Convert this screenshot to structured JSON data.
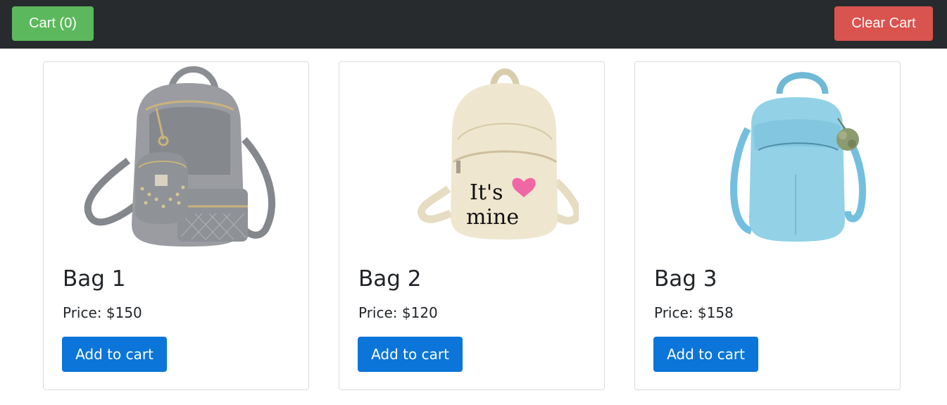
{
  "navbar": {
    "cart_label": "Cart (0)",
    "clear_label": "Clear Cart"
  },
  "products": [
    {
      "name": "Bag 1",
      "price": "Price: $150",
      "button": "Add to cart",
      "image": "grey-backpack-with-pouch"
    },
    {
      "name": "Bag 2",
      "price": "Price: $120",
      "button": "Add to cart",
      "image": "beige-backpack-its-mine"
    },
    {
      "name": "Bag 3",
      "price": "Price: $158",
      "button": "Add to cart",
      "image": "light-blue-backpack-with-pompom"
    }
  ],
  "image_text": {
    "line1": "It's",
    "line2": "mine"
  },
  "colors": {
    "navbar": "#272b2e",
    "cart_button": "#5cb85c",
    "clear_button": "#d9534f",
    "add_button": "#0b75d9"
  }
}
